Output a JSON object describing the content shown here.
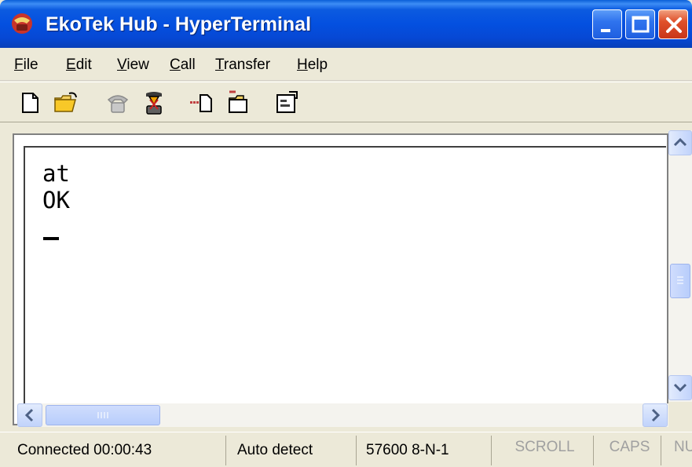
{
  "window": {
    "title": "EkoTek Hub - HyperTerminal"
  },
  "menu": {
    "items": [
      {
        "prefix": "",
        "ul": "F",
        "rest": "ile"
      },
      {
        "prefix": "",
        "ul": "E",
        "rest": "dit"
      },
      {
        "prefix": "",
        "ul": "V",
        "rest": "iew"
      },
      {
        "prefix": "",
        "ul": "C",
        "rest": "all"
      },
      {
        "prefix": "",
        "ul": "T",
        "rest": "ransfer"
      },
      {
        "prefix": "",
        "ul": "H",
        "rest": "elp"
      }
    ]
  },
  "toolbar": {
    "icons": [
      "new-document-icon",
      "open-folder-icon",
      "connect-phone-icon",
      "disconnect-phone-icon",
      "send-file-icon",
      "receive-file-icon",
      "properties-icon"
    ]
  },
  "terminal": {
    "line1": "at",
    "line2": "OK"
  },
  "status": {
    "connection": "Connected 00:00:43",
    "emulation": "Auto detect",
    "port_settings": "57600 8-N-1",
    "scroll": "SCROLL",
    "caps": "CAPS",
    "num": "NUM"
  },
  "colors": {
    "title_bar": "#0450e0",
    "close_button": "#e0502a",
    "window_bg": "#ece9d8"
  }
}
